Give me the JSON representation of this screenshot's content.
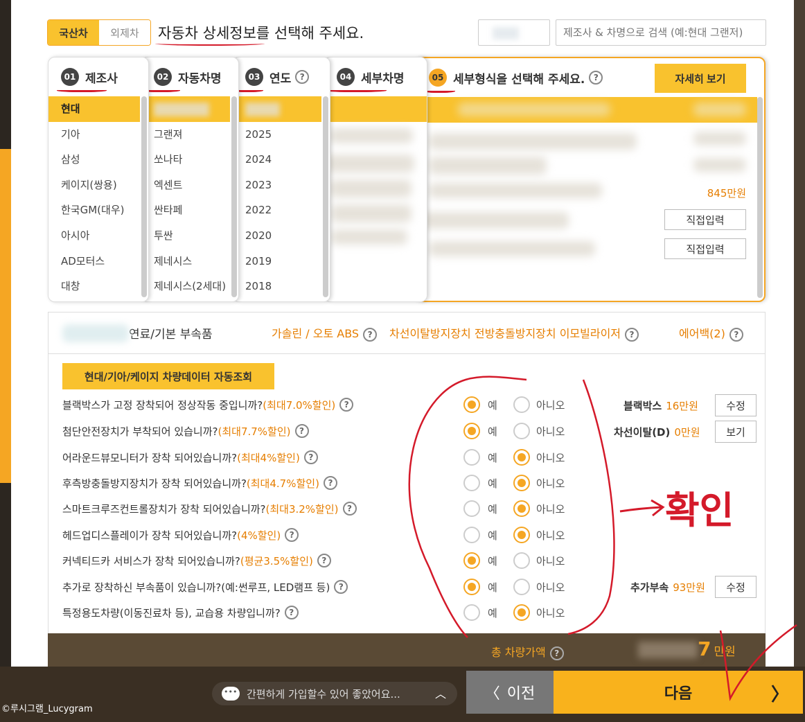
{
  "origin_toggle": {
    "domestic": "국산차",
    "import": "외제차"
  },
  "prompt_text": "자동차 상세정보를 선택해 주세요.",
  "search": {
    "placeholder": "제조사 & 차명으로 검색 (예:현대 그랜저)"
  },
  "columns": {
    "maker": {
      "num": "01",
      "title": "제조사",
      "items": [
        "현대",
        "기아",
        "삼성",
        "케이지(쌍용)",
        "한국GM(대우)",
        "아시아",
        "AD모터스",
        "대창"
      ]
    },
    "model": {
      "num": "02",
      "title": "자동차명",
      "items": [
        "그랜져",
        "쏘나타",
        "엑센트",
        "싼타페",
        "투싼",
        "제네시스",
        "제네시스(2세대)"
      ]
    },
    "year": {
      "num": "03",
      "title": "연도",
      "items": [
        "2025",
        "2024",
        "2023",
        "2022",
        "2020",
        "2019",
        "2018"
      ]
    },
    "detail_name": {
      "num": "04",
      "title": "세부차명"
    },
    "detail_type": {
      "num": "05",
      "title": "세부형식을 선택해 주세요.",
      "detail_button": "자세히 보기",
      "price": "845만원",
      "direct_input_1": "직접입력",
      "direct_input_2": "직접입력"
    }
  },
  "options_header": {
    "suffix": "연료/기본 부속품",
    "fuel": "가솔린 / 오토 ABS",
    "safety": "차선이탈방지장치 전방충돌방지장치 이모빌라이저",
    "airbag": "에어백(2)"
  },
  "auto_lookup_button": "현대/기아/케이지 차량데이터 자동조회",
  "radio_yes": "예",
  "radio_no": "아니오",
  "questions": [
    {
      "text": "블랙박스가 고정 장착되어 정상작동 중입니까?",
      "hint": "(최대7.0%할인)",
      "answer": "yes"
    },
    {
      "text": "첨단안전장치가 부착되어 있습니까?",
      "hint": "(최대7.7%할인)",
      "answer": "yes"
    },
    {
      "text": "어라운드뷰모니터가 장착 되어있습니까?",
      "hint": "(최대4%할인)",
      "answer": "no"
    },
    {
      "text": "후측방충돌방지장치가 장착 되어있습니까?",
      "hint": "(최대4.7%할인)",
      "answer": "no"
    },
    {
      "text": "스마트크루즈컨트롤장치가 장착 되어있습니까?",
      "hint": "(최대3.2%할인)",
      "answer": "no"
    },
    {
      "text": "헤드업디스플레이가 장착 되어있습니까?",
      "hint": "(4%할인)",
      "answer": "no"
    },
    {
      "text": "커넥티드카 서비스가 장착 되어있습니까?",
      "hint": "(평균3.5%할인)",
      "answer": "yes"
    },
    {
      "text": "추가로 장착하신 부속품이 있습니까?(예:썬루프, LED램프 등)",
      "hint": "",
      "answer": "yes"
    },
    {
      "text": "특정용도차량(이동진료차 등), 교습용 차량입니까?",
      "hint": "",
      "answer": "no"
    }
  ],
  "side_info": {
    "blackbox": {
      "label": "블랙박스",
      "price": "16만원",
      "button": "수정"
    },
    "lane": {
      "label": "차선이탈(D)",
      "price": "0만원",
      "button": "보기"
    },
    "extra": {
      "label": "추가부속",
      "price": "93만원",
      "button": "수정"
    }
  },
  "total": {
    "label": "총 차량가액",
    "value_tail": "7",
    "unit": "만원"
  },
  "chat_text": "간편하게 가입할수 있어 좋았어요...",
  "nav": {
    "prev": "이전",
    "next": "다음"
  },
  "annotation_text": "확인",
  "watermark": "©루시그램_Lucygram",
  "colors": {
    "accent": "#f9c22e",
    "accent_dark": "#f5a623",
    "price": "#e67e00",
    "annotation": "#d41a2a"
  }
}
